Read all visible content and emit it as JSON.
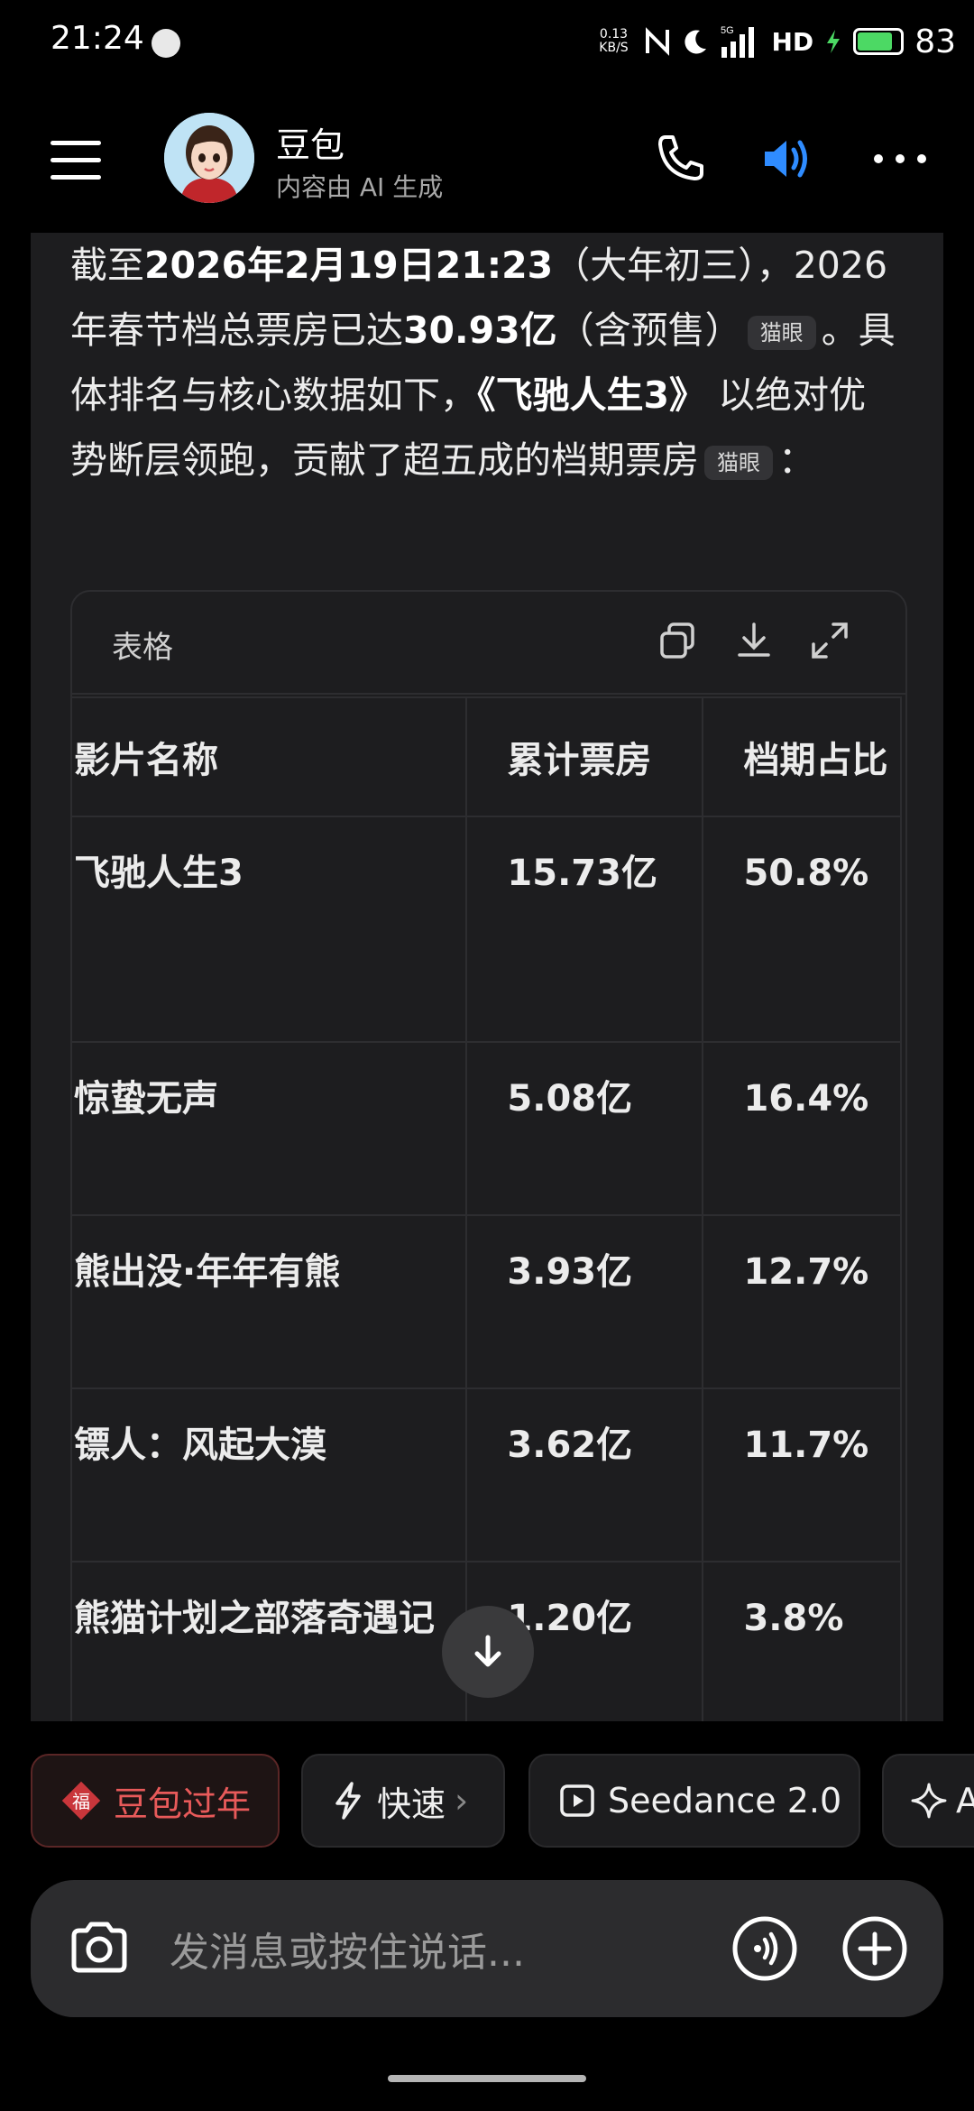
{
  "status_bar": {
    "time": "21:24",
    "net_speed_value": "0.13",
    "net_speed_unit": "KB/S",
    "signal_label": "5G",
    "hd_label": "HD",
    "battery_level": "83"
  },
  "header": {
    "bot_name": "豆包",
    "subtitle": "内容由 AI 生成",
    "icons": [
      "menu-icon",
      "phone-icon",
      "speaker-icon",
      "more-icon"
    ]
  },
  "message": {
    "parts": {
      "p1": "截至",
      "p2": "2026年2月19日21:23",
      "p3": "（大年初三），2026年春节档总票房已达",
      "p4": "30.93亿",
      "p5": "（含预售）",
      "cite1": "猫眼",
      "p6": "。具体排名与核心数据如下，",
      "p7": "《飞驰人生3》",
      "p8": " 以绝对优势断层领跑，贡献了超五成的档期票房",
      "cite2": "猫眼",
      "p9": "："
    }
  },
  "table": {
    "title": "表格",
    "header_icons": [
      "copy-icon",
      "download-icon",
      "expand-icon"
    ],
    "columns": [
      "影片名称",
      "累计票房",
      "档期占比"
    ],
    "rows": [
      {
        "name": "飞驰人生3",
        "box_office": "15.73亿",
        "share": "50.8%"
      },
      {
        "name": "惊蛰无声",
        "box_office": "5.08亿",
        "share": "16.4%"
      },
      {
        "name": "熊出没·年年有熊",
        "box_office": "3.93亿",
        "share": "12.7%"
      },
      {
        "name": "镖人：风起大漠",
        "box_office": "3.62亿",
        "share": "11.7%"
      },
      {
        "name": "熊猫计划之部落奇遇记",
        "box_office": "1.20亿",
        "share": "3.8%"
      }
    ]
  },
  "chips": {
    "festival": "豆包过年",
    "festival_glyph": "福",
    "fast": "快速",
    "fast_chevron": "›",
    "seedance": "Seedance 2.0",
    "fourth": "A"
  },
  "input": {
    "placeholder": "发消息或按住说话..."
  },
  "colors": {
    "accent_blue": "#2f8cff",
    "festival_red": "#e85a5a",
    "battery_green": "#4cd964"
  }
}
